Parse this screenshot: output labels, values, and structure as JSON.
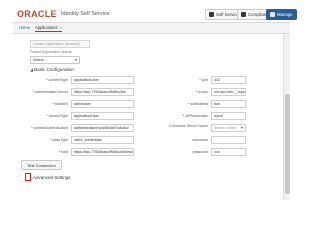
{
  "header": {
    "logo": "ORACLE",
    "app_name": "Identity Self Service",
    "buttons": [
      {
        "label": "Self Service",
        "icon": "user-icon"
      },
      {
        "label": "Compliance",
        "icon": "shield-icon"
      },
      {
        "label": "Manage",
        "icon": "gear-icon"
      }
    ]
  },
  "tabs": {
    "home": "Home",
    "applications": "Applications",
    "close": "×"
  },
  "top_form": {
    "ghost_field": "Create Application (Access)",
    "select_label": "Parent Application Name",
    "select_value": "Select ..."
  },
  "basic_configuration": {
    "title": "Basic Configuration",
    "left_fields": [
      {
        "label": "contextType",
        "value": "applicationUser",
        "required": true
      },
      {
        "label": "authenticationServer",
        "value": "https://ssc-77654bacc9fd5b/z8m",
        "required": true
      },
      {
        "label": "baseDN",
        "value": "adminuser",
        "required": true
      },
      {
        "label": "contextType",
        "value": "applicationUser",
        "required": true
      },
      {
        "label": "contextAuthentication",
        "value": "authenticationHost/5b0c6f7a4da1f",
        "required": true
      },
      {
        "label": "passType",
        "value": "client_credentials",
        "required": true
      },
      {
        "label": "host",
        "value": "https://ssc-77654bacc9fd5b/z8m0/scim/v2",
        "required": true
      }
    ],
    "right_fields": [
      {
        "label": "port",
        "value": "443",
        "placeholder": false,
        "required": true
      },
      {
        "label": "scope",
        "value": "urn:opc:idm:__myscopes__",
        "placeholder": false,
        "required": true
      },
      {
        "label": "sslEnabled",
        "value": "true",
        "placeholder": false,
        "required": true
      },
      {
        "label": "uriPlaceholder",
        "value": "myuri",
        "placeholder": false,
        "required": true
      },
      {
        "label": "Connector Server Name",
        "value": "Select a value",
        "placeholder": true,
        "required": false,
        "dropdown": true
      },
      {
        "label": "username",
        "value": "",
        "placeholder": false,
        "required": false
      },
      {
        "label": "password",
        "value": "•••••",
        "placeholder": false,
        "required": false
      }
    ]
  },
  "actions": {
    "test_connection": "Test Connection"
  },
  "advanced": {
    "label": "Advanced Settings"
  },
  "colors": {
    "brand_red": "#c74634",
    "primary_blue": "#2a5f95",
    "highlight_red": "#e0201a"
  }
}
